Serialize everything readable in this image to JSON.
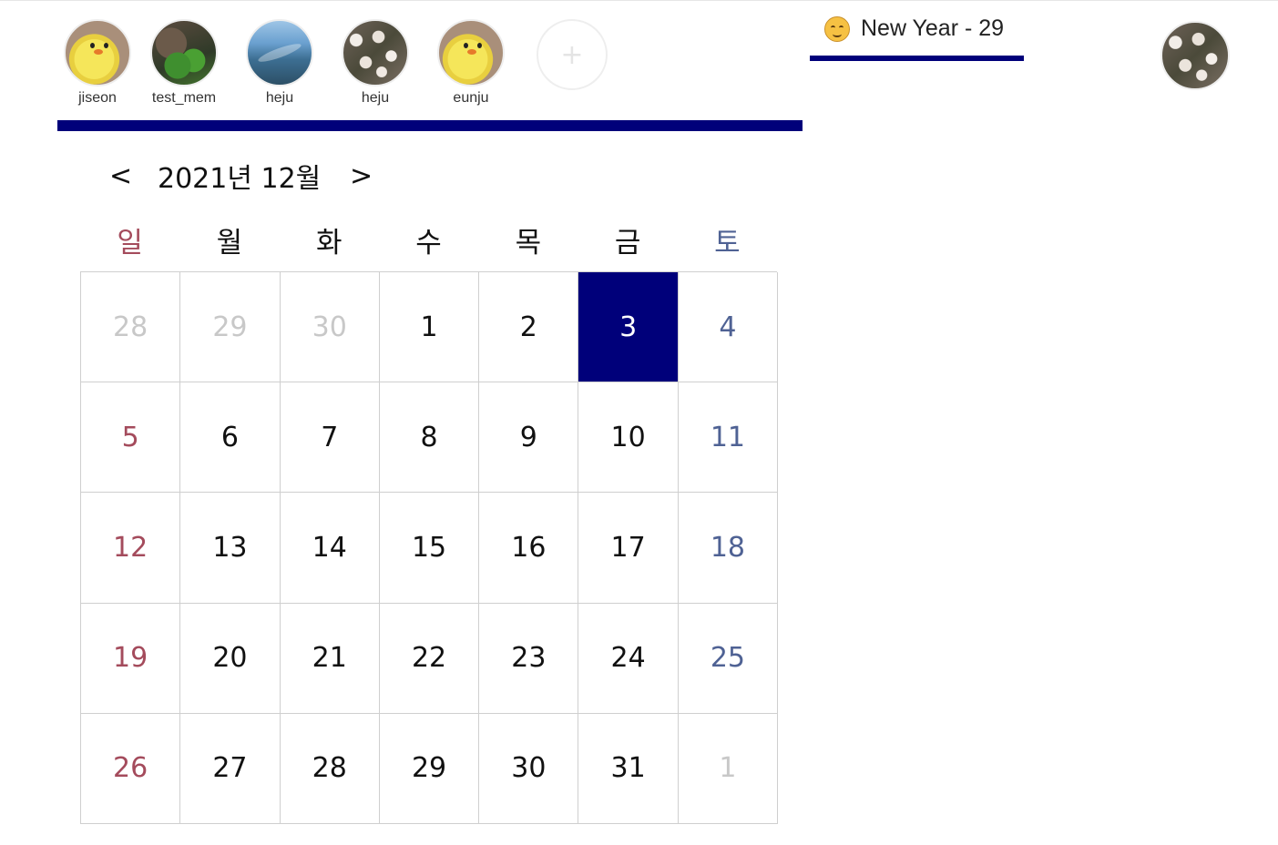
{
  "members": [
    {
      "name": "jiseon",
      "avatar": "chick-avatar"
    },
    {
      "name": "test_mem",
      "avatar": "cactus-avatar"
    },
    {
      "name": "heju",
      "avatar": "aquarium-avatar"
    },
    {
      "name": "heju",
      "avatar": "blossom-avatar"
    },
    {
      "name": "eunju",
      "avatar": "chick-avatar"
    }
  ],
  "add_member_symbol": "+",
  "group": {
    "emoji": "hugging-face-emoji",
    "title": "New Year - 29"
  },
  "profile": {
    "avatar": "blossom-avatar"
  },
  "calendar": {
    "prev_label": "<",
    "month_label": "2021년 12월",
    "next_label": ">",
    "weekdays": [
      "일",
      "월",
      "화",
      "수",
      "목",
      "금",
      "토"
    ],
    "days": [
      [
        "28",
        "29",
        "30",
        "1",
        "2",
        "3",
        "4"
      ],
      [
        "5",
        "6",
        "7",
        "8",
        "9",
        "10",
        "11"
      ],
      [
        "12",
        "13",
        "14",
        "15",
        "16",
        "17",
        "18"
      ],
      [
        "19",
        "20",
        "21",
        "22",
        "23",
        "24",
        "25"
      ],
      [
        "26",
        "27",
        "28",
        "29",
        "30",
        "31",
        "1"
      ]
    ],
    "selected_day": "3"
  },
  "colors": {
    "accent": "#00007a",
    "sunday": "#a44b5c",
    "saturday": "#4f6294",
    "muted": "#c8c8c8"
  }
}
